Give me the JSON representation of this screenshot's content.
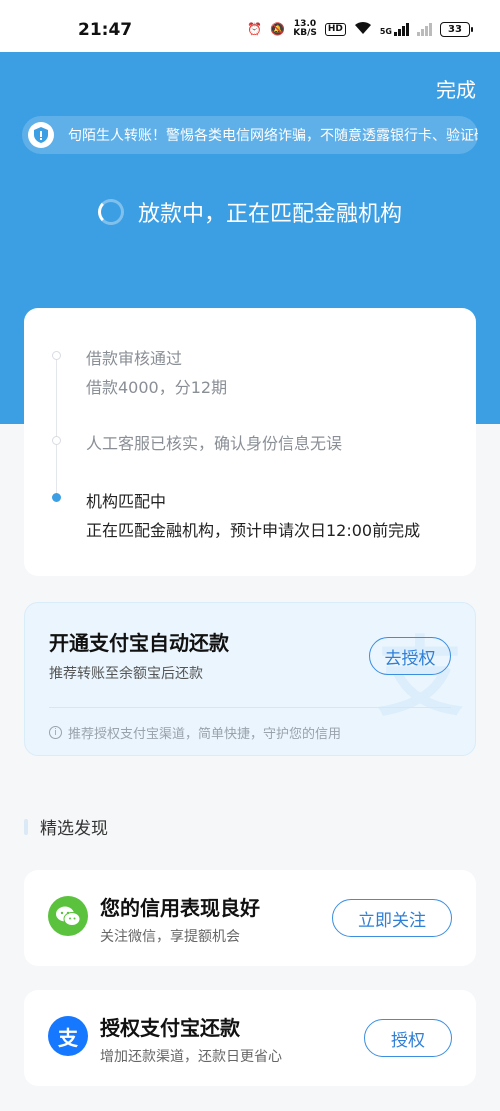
{
  "status_bar": {
    "time": "21:47",
    "net_speed_value": "13.0",
    "net_speed_unit": "KB/S",
    "hd_label": "HD",
    "network_label": "5G",
    "battery_level": "33"
  },
  "header": {
    "done_label": "完成",
    "notice_text": "句陌生人转账！警惕各类电信网络诈骗，不随意透露银行卡、验证码",
    "loading_status": "放款中，正在匹配金融机构"
  },
  "timeline": [
    {
      "title": "借款审核通过",
      "desc": "借款4000，分12期",
      "state": "done"
    },
    {
      "title": "人工客服已核实，确认身份信息无误",
      "desc": "",
      "state": "done"
    },
    {
      "title": "机构匹配中",
      "desc": "正在匹配金融机构，预计申请次日12:00前完成",
      "state": "active"
    }
  ],
  "alipay_autopay": {
    "title": "开通支付宝自动还款",
    "subtitle": "推荐转账至余额宝后还款",
    "button_label": "去授权",
    "watermark": "支",
    "hint": "推荐授权支付宝渠道，简单快捷，守护您的信用"
  },
  "discover": {
    "section_title": "精选发现",
    "items": [
      {
        "title": "您的信用表现良好",
        "subtitle": "关注微信，享提额机会",
        "button_label": "立即关注",
        "icon": "wechat-icon"
      },
      {
        "title": "授权支付宝还款",
        "subtitle": "增加还款渠道，还款日更省心",
        "button_label": "授权",
        "icon": "alipay-icon",
        "icon_glyph": "支"
      }
    ]
  },
  "colors": {
    "primary_blue": "#3c9fe4",
    "button_blue": "#2f7fd6",
    "wechat_green": "#5ac23d",
    "alipay_blue": "#1677ff"
  }
}
